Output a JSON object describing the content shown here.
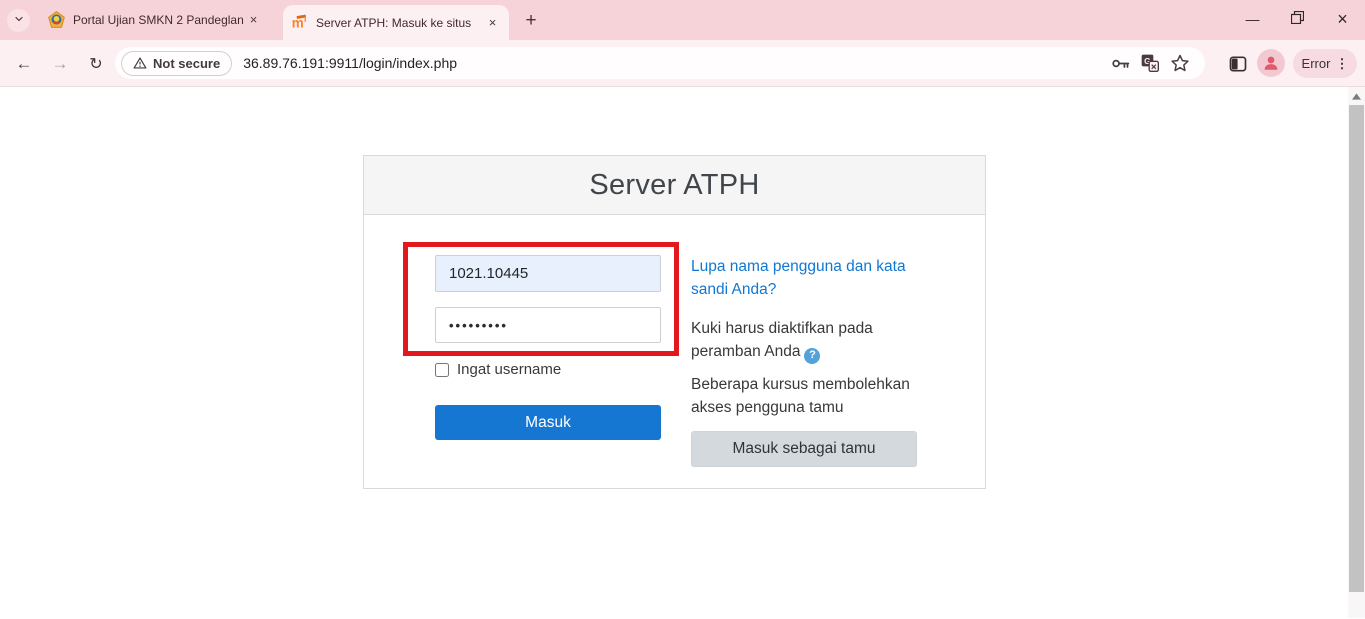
{
  "browser": {
    "tabs": [
      {
        "title": "Portal Ujian SMKN 2 Pandeglan",
        "close_glyph": "×"
      },
      {
        "title": "Server ATPH: Masuk ke situs",
        "close_glyph": "×"
      }
    ],
    "new_tab_glyph": "+",
    "window_controls": {
      "minimize": "—",
      "close": "×"
    },
    "nav": {
      "back": "←",
      "forward": "→",
      "reload": "↻"
    },
    "omnibox": {
      "security_chip": "Not secure",
      "url": "36.89.76.191:9911/login/index.php"
    },
    "menu": {
      "error_label": "Error",
      "dots_glyph": "⋮"
    },
    "scrollbar_up_glyph": "▲"
  },
  "login": {
    "title": "Server ATPH",
    "username": {
      "value": "1021.10445"
    },
    "password": {
      "value": "•••••••••"
    },
    "remember_label": "Ingat username",
    "submit_label": "Masuk",
    "forgot_link": "Lupa nama pengguna dan kata sandi Anda?",
    "cookies_text": "Kuki harus diaktifkan pada peramban Anda",
    "help_glyph": "?",
    "guest_text": "Beberapa kursus membolehkan akses pengguna tamu",
    "guest_button": "Masuk sebagai tamu"
  },
  "colors": {
    "accent_blue": "#1577d2",
    "link_blue": "#1277d1",
    "annotation_red": "#e2181f",
    "tabbar_pink": "#f6d3d9",
    "toolbar_pink": "#fdf0f3",
    "autofill_blue": "#e8f0fe",
    "guest_gray": "#d3d9dd"
  }
}
